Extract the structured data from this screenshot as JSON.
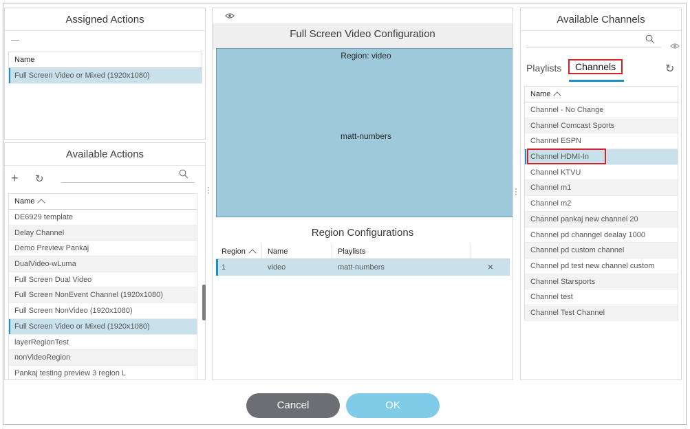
{
  "assigned_actions": {
    "title": "Assigned Actions",
    "column": "Name",
    "rows": [
      "Full Screen Video or Mixed (1920x1080)"
    ]
  },
  "available_actions": {
    "title": "Available Actions",
    "column": "Name",
    "rows": [
      "DE6929 template",
      "Delay Channel",
      "Demo Preview Pankaj",
      "DualVideo-wLuma",
      "Full Screen Dual Video",
      "Full Screen NonEvent Channel (1920x1080)",
      "Full Screen NonVideo (1920x1080)",
      "Full Screen Video or Mixed (1920x1080)",
      "layerRegionTest",
      "nonVideoRegion",
      "Pankaj testing preview 3 region L"
    ],
    "selected_index": 7
  },
  "center": {
    "title": "Full Screen Video Configuration",
    "region_label": "Region: video",
    "region_content": "matt-numbers",
    "region_config_title": "Region Configurations",
    "columns": [
      "Region",
      "Name",
      "Playlists"
    ],
    "rows": [
      {
        "region": "1",
        "name": "video",
        "playlists": "matt-numbers"
      }
    ]
  },
  "channels": {
    "title": "Available Channels",
    "tabs": [
      "Playlists",
      "Channels"
    ],
    "active_tab": "Channels",
    "column": "Name",
    "rows": [
      "Channel - No Change",
      "Channel Comcast Sports",
      "Channel ESPN",
      "Channel HDMI-In",
      "Channel KTVU",
      "Channel m1",
      "Channel m2",
      "Channel pankaj new channel 20",
      "Channel pd channgel dealay 1000",
      "Channel pd custom channel",
      "Channel pd test new channel custom",
      "Channel Starsports",
      "Channel test",
      "Channel Test Channel"
    ],
    "selected_index": 3
  },
  "buttons": {
    "cancel": "Cancel",
    "ok": "OK"
  },
  "colors": {
    "accent": "#1d8fc5",
    "selected_row": "#c9e1ea",
    "region_fill": "#9dc9db",
    "highlight_box": "#d0232a",
    "cancel_button": "#6c6e73",
    "ok_button": "#7fcbe8"
  }
}
